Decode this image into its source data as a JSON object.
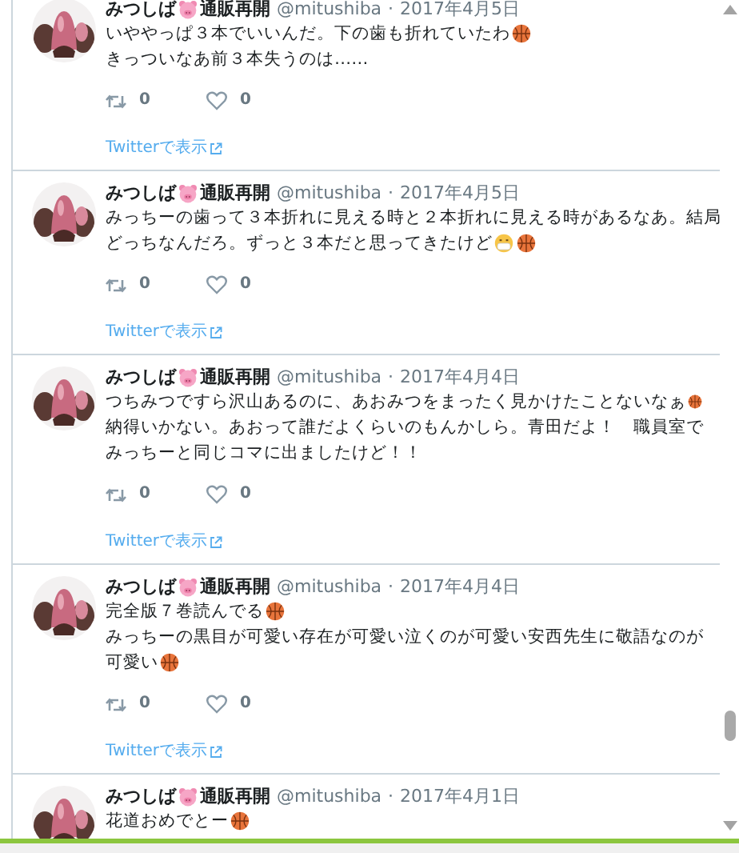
{
  "tweets": [
    {
      "name": [
        {
          "kind": "text",
          "text": "みつしば"
        },
        {
          "kind": "pig"
        },
        {
          "kind": "text",
          "text": "通販再開"
        }
      ],
      "handle": "@mitushiba",
      "separator": "·",
      "date": "2017年4月5日",
      "lines": [
        [
          {
            "kind": "text",
            "text": "いややっぱ３本でいいんだ。下の歯も折れていたわ"
          },
          {
            "kind": "basketball"
          }
        ],
        [
          {
            "kind": "text",
            "text": "きっついなあ前３本失うのは……"
          }
        ]
      ],
      "retweets": "0",
      "likes": "0",
      "link": "Twitterで表示"
    },
    {
      "name": [
        {
          "kind": "text",
          "text": "みつしば"
        },
        {
          "kind": "pig"
        },
        {
          "kind": "text",
          "text": "通販再開"
        }
      ],
      "handle": "@mitushiba",
      "separator": "·",
      "date": "2017年4月5日",
      "lines": [
        [
          {
            "kind": "text",
            "text": "みっちーの歯って３本折れに見える時と２本折れに見える時があるなあ。結局"
          }
        ],
        [
          {
            "kind": "text",
            "text": "どっちなんだろ。ずっと３本だと思ってきたけど"
          },
          {
            "kind": "mask"
          },
          {
            "kind": "basketball"
          }
        ]
      ],
      "retweets": "0",
      "likes": "0",
      "link": "Twitterで表示"
    },
    {
      "name": [
        {
          "kind": "text",
          "text": "みつしば"
        },
        {
          "kind": "pig"
        },
        {
          "kind": "text",
          "text": "通販再開"
        }
      ],
      "handle": "@mitushiba",
      "separator": "·",
      "date": "2017年4月4日",
      "lines": [
        [
          {
            "kind": "text",
            "text": "つちみつですら沢山あるのに、あおみつをまったく見かけたことないなぁ"
          },
          {
            "kind": "basketball"
          }
        ],
        [
          {
            "kind": "text",
            "text": "納得いかない。あおって誰だよくらいのもんかしら。青田だよ！　職員室で"
          }
        ],
        [
          {
            "kind": "text",
            "text": "みっちーと同じコマに出ましたけど！！"
          }
        ]
      ],
      "retweets": "0",
      "likes": "0",
      "link": "Twitterで表示"
    },
    {
      "name": [
        {
          "kind": "text",
          "text": "みつしば"
        },
        {
          "kind": "pig"
        },
        {
          "kind": "text",
          "text": "通販再開"
        }
      ],
      "handle": "@mitushiba",
      "separator": "·",
      "date": "2017年4月4日",
      "lines": [
        [
          {
            "kind": "text",
            "text": "完全版７巻読んでる"
          },
          {
            "kind": "basketball"
          }
        ],
        [
          {
            "kind": "text",
            "text": "みっちーの黒目が可愛い存在が可愛い泣くのが可愛い安西先生に敬語なのが"
          }
        ],
        [
          {
            "kind": "text",
            "text": "可愛い"
          },
          {
            "kind": "basketball"
          }
        ]
      ],
      "retweets": "0",
      "likes": "0",
      "link": "Twitterで表示"
    },
    {
      "name": [
        {
          "kind": "text",
          "text": "みつしば"
        },
        {
          "kind": "pig"
        },
        {
          "kind": "text",
          "text": "通販再開"
        }
      ],
      "handle": "@mitushiba",
      "separator": "·",
      "date": "2017年4月1日",
      "lines": [
        [
          {
            "kind": "text",
            "text": "花道おめでとー"
          },
          {
            "kind": "basketball"
          }
        ]
      ]
    }
  ]
}
